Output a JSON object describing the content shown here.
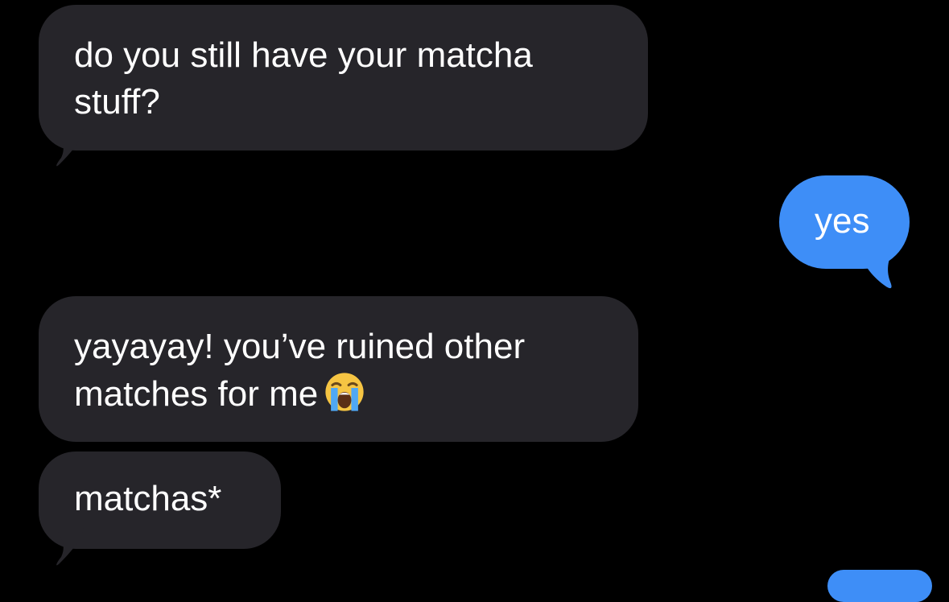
{
  "messages": [
    {
      "direction": "incoming",
      "text_line1": "do you still have your matcha",
      "text_line2": "stuff?"
    },
    {
      "direction": "outgoing",
      "text": "yes"
    },
    {
      "direction": "incoming",
      "text_line1": "yayayay! you’ve ruined other",
      "text_line2": "matches for me",
      "emoji": "loudly-crying-face"
    },
    {
      "direction": "incoming",
      "text": "matchas*"
    }
  ],
  "colors": {
    "background": "#000000",
    "incoming_bubble": "#26252a",
    "outgoing_bubble": "#3e8ef7",
    "text": "#ffffff"
  }
}
